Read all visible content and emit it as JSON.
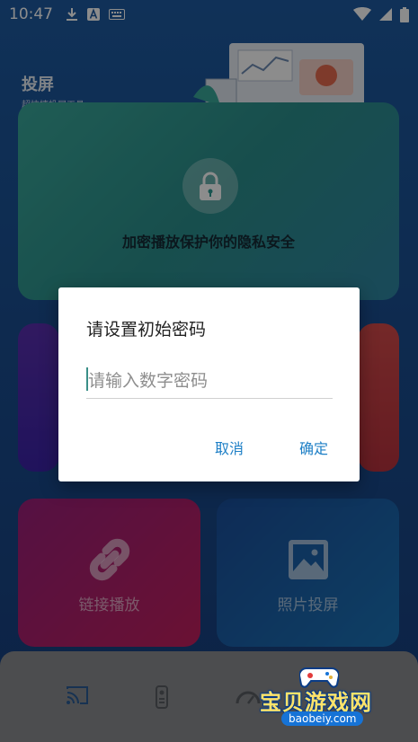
{
  "status_bar": {
    "time": "10:47",
    "icons_left": [
      "download-icon",
      "font-a-icon",
      "keyboard-icon"
    ],
    "icons_right": [
      "wifi-icon",
      "signal-icon",
      "battery-icon"
    ]
  },
  "header": {
    "title": "投屏",
    "subtitle": "超快捷投屏工具"
  },
  "cards": {
    "top": {
      "caption": "加密播放保护你的隐私安全",
      "icon": "lock-icon"
    },
    "link": {
      "label": "链接播放",
      "icon": "link-icon"
    },
    "photo": {
      "label": "照片投屏",
      "icon": "image-icon"
    }
  },
  "bottom_nav": {
    "items": [
      "cast-icon",
      "remote-icon",
      "speed-icon"
    ]
  },
  "dialog": {
    "title": "请设置初始密码",
    "input_placeholder": "请输入数字密码",
    "input_value": "",
    "cancel_label": "取消",
    "ok_label": "确定"
  },
  "watermark": {
    "text": "宝贝游戏网",
    "url": "baobeiy.com"
  },
  "colors": {
    "accent": "#1d7fc6",
    "top_card": "#2f9a92",
    "link_card": "#b0206a",
    "photo_card": "#1b62aa",
    "nav_bg": "#8a8d91"
  }
}
